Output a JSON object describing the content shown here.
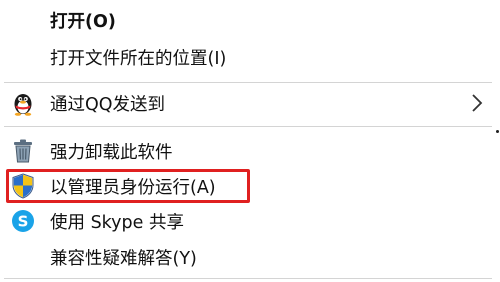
{
  "context_menu": {
    "items": [
      {
        "label": "打开(O)",
        "bold": true
      },
      {
        "label": "打开文件所在的位置(I)"
      },
      {
        "label": "通过QQ发送到",
        "icon": "qq-penguin-icon",
        "submenu": true
      },
      {
        "label": "强力卸载此软件",
        "icon": "trash-bin-icon"
      },
      {
        "label": "以管理员身份运行(A)",
        "icon": "uac-shield-icon"
      },
      {
        "label": "使用 Skype 共享",
        "icon": "skype-icon"
      },
      {
        "label": "兼容性疑难解答(Y)"
      }
    ],
    "submenu_icon": "chevron-right-icon",
    "highlight_color": "#e02020"
  }
}
